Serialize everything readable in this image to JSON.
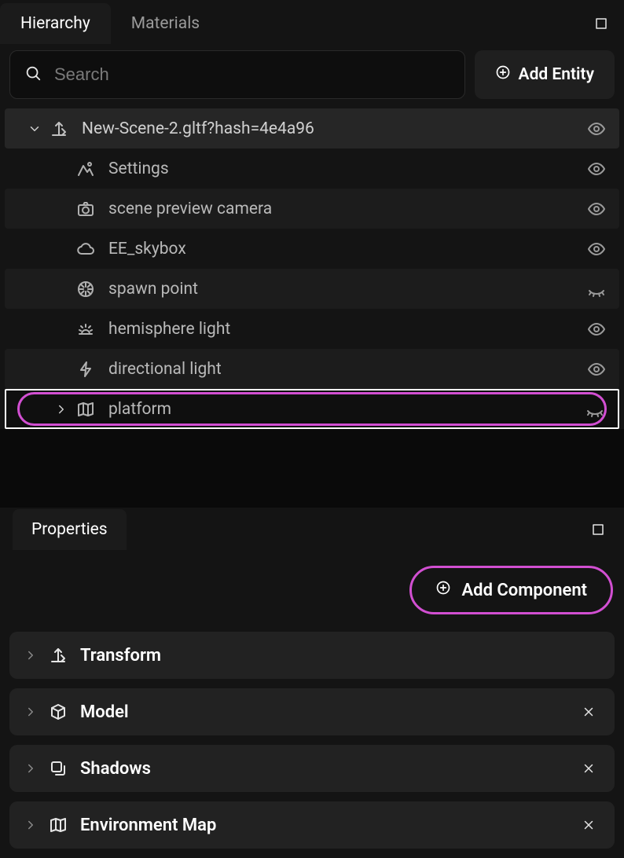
{
  "tabs": {
    "hierarchy": "Hierarchy",
    "materials": "Materials"
  },
  "search": {
    "placeholder": "Search"
  },
  "add_entity_label": "Add Entity",
  "tree": {
    "root": {
      "label": "New-Scene-2.gltf?hash=4e4a96",
      "visible": true
    },
    "children": [
      {
        "icon": "mountain",
        "label": "Settings",
        "visible": true,
        "alt": false
      },
      {
        "icon": "camera",
        "label": "scene preview camera",
        "visible": true,
        "alt": true
      },
      {
        "icon": "cloud",
        "label": "EE_skybox",
        "visible": true,
        "alt": false
      },
      {
        "icon": "aperture",
        "label": "spawn point",
        "visible": false,
        "alt": true
      },
      {
        "icon": "sunrise",
        "label": "hemisphere light",
        "visible": true,
        "alt": false
      },
      {
        "icon": "bolt",
        "label": "directional light",
        "visible": true,
        "alt": true
      },
      {
        "icon": "map",
        "label": "platform",
        "visible": false,
        "alt": false,
        "selected": true,
        "has_children": true
      }
    ]
  },
  "properties": {
    "title": "Properties",
    "add_component_label": "Add Component",
    "components": [
      {
        "icon": "axes",
        "label": "Transform",
        "removable": false
      },
      {
        "icon": "cube",
        "label": "Model",
        "removable": true
      },
      {
        "icon": "shadows",
        "label": "Shadows",
        "removable": true
      },
      {
        "icon": "map",
        "label": "Environment Map",
        "removable": true
      }
    ]
  }
}
